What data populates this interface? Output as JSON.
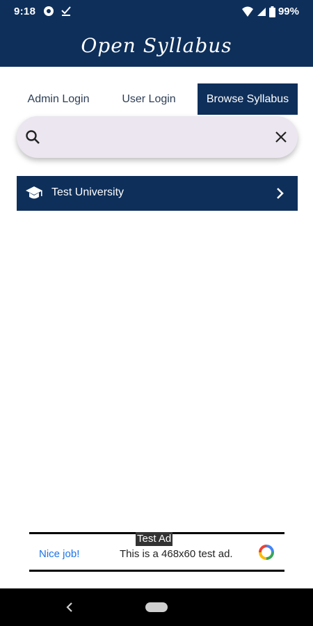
{
  "status_bar": {
    "time": "9:18",
    "battery": "99%"
  },
  "app_bar": {
    "title": "Open Syllabus"
  },
  "tabs": [
    {
      "label": "Admin Login"
    },
    {
      "label": "User Login"
    },
    {
      "label": "Browse Syllabus",
      "selected": true
    }
  ],
  "search": {
    "value": "",
    "placeholder": ""
  },
  "list": {
    "items": [
      {
        "label": "Test University",
        "icon": "graduation-cap-icon"
      }
    ]
  },
  "ad": {
    "badge": "Test Ad",
    "link_text": "Nice job!",
    "text": "This is a 468x60 test ad."
  },
  "colors": {
    "primary": "#0e2f5a",
    "search_bg": "#ebe6ef",
    "ad_link": "#1a73e8"
  }
}
